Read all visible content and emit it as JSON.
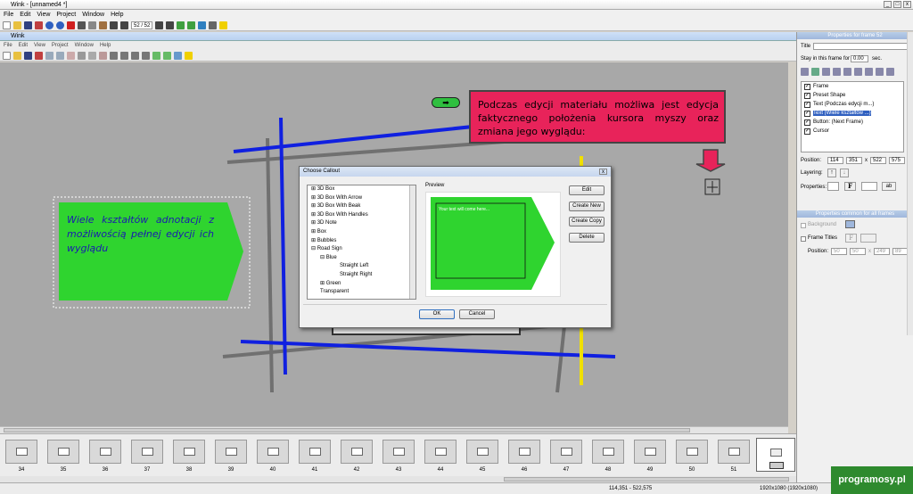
{
  "window": {
    "title": "Wink - [unnamed4 *]"
  },
  "menu": [
    "File",
    "Edit",
    "View",
    "Project",
    "Window",
    "Help"
  ],
  "toolbar": {
    "page": "52 / 52"
  },
  "inner_window": {
    "title": "Wink",
    "menu": [
      "File",
      "Edit",
      "View",
      "Project",
      "Window",
      "Help"
    ]
  },
  "canvas": {
    "callout_green_text": "Wiele kształtów adnotacji z możliwością pełnej edycji ich wyglądu",
    "callout_pink_text": "Podczas edycji materiału możliwa jest edycja faktycznego położenia kursora myszy oraz zmiana jego wyglądu:",
    "colors": {
      "background": "#a8a8a8",
      "green": "#2fd42f",
      "pink": "#e8235a",
      "blue_line": "#1020e0",
      "yellow_line": "#f0e000",
      "grey_line": "#707070"
    }
  },
  "dialog": {
    "title": "Choose Callout",
    "tree": [
      "3D Box",
      "3D Box With Arrow",
      "3D Box With Beak",
      "3D Box With Handles",
      "3D Note",
      "Box",
      "Bubbles",
      "Road Sign",
      "Blue",
      "Straight Left",
      "Straight Right",
      "Green",
      "Transparent"
    ],
    "preview_label": "Preview",
    "preview_text": "Your text will come here...",
    "buttons": {
      "edit": "Edit",
      "create_new": "Create New",
      "create_copy": "Create Copy",
      "delete": "Delete",
      "ok": "OK",
      "cancel": "Cancel"
    }
  },
  "panel": {
    "header": "Properties for frame 52",
    "title_label": "Title",
    "stay_label": "Stay in this frame for",
    "stay_value": "0.00",
    "stay_unit": "sec.",
    "layers": [
      "Frame",
      "Preset Shape",
      "Text (Podczas edycji m...)",
      "Text (Wiele kształtów ...)",
      "Button: (Next Frame)",
      "Cursor"
    ],
    "position_label": "Position:",
    "position": [
      "114",
      "351",
      "522",
      "575"
    ],
    "x_label": "x",
    "layering_label": "Layering:",
    "properties_label": "Properties:",
    "all_header": "Properties common for all frames",
    "background_label": "Background",
    "frame_titles_label": "Frame Titles",
    "all_position": [
      "50",
      "50",
      "249",
      "89"
    ]
  },
  "thumbnails": [
    "34",
    "35",
    "36",
    "37",
    "38",
    "39",
    "40",
    "41",
    "42",
    "43",
    "44",
    "45",
    "46",
    "47",
    "48",
    "49",
    "50",
    "51"
  ],
  "status": {
    "coords": "114,351 - 522,575",
    "resolution": "1920x1080 (1920x1080)"
  },
  "watermark": "programosy.pl"
}
